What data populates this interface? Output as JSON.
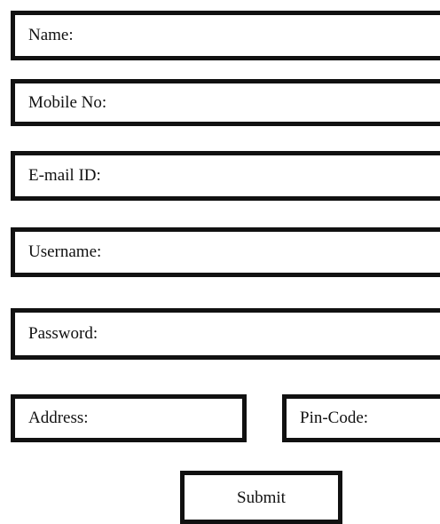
{
  "form": {
    "fields": {
      "name": {
        "label": "Name:"
      },
      "mobile": {
        "label": "Mobile No:"
      },
      "email": {
        "label": "E-mail ID:"
      },
      "username": {
        "label": "Username:"
      },
      "password": {
        "label": "Password:"
      },
      "address": {
        "label": "Address:"
      },
      "pincode": {
        "label": "Pin-Code:"
      }
    },
    "submit_label": "Submit"
  },
  "colors": {
    "border": "#111111",
    "background": "#ffffff",
    "text": "#111111"
  }
}
